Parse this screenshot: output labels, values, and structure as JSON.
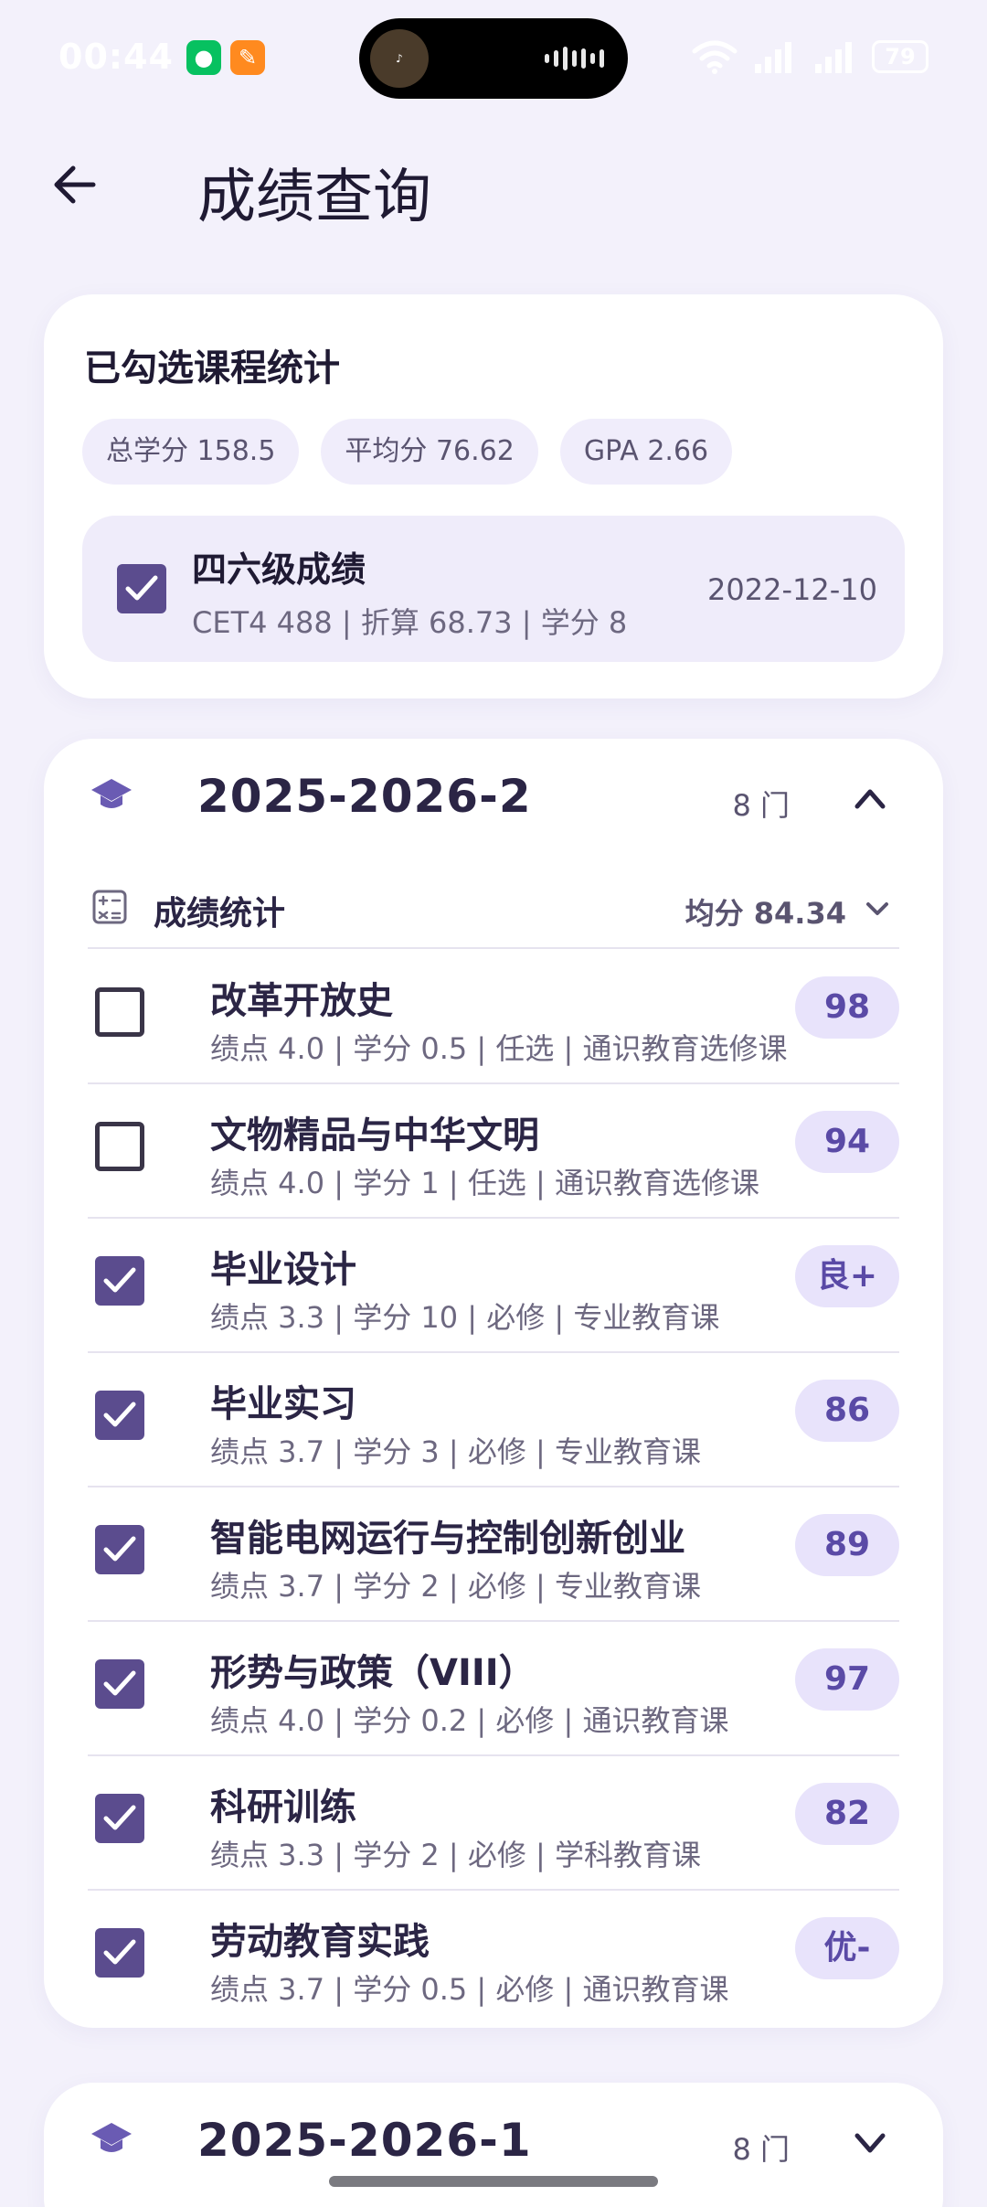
{
  "status_bar": {
    "time": "00:44",
    "battery": "79"
  },
  "header": {
    "title": "成绩查询"
  },
  "summary": {
    "title": "已勾选课程统计",
    "chips": [
      "总学分 158.5",
      "平均分 76.62",
      "GPA 2.66"
    ],
    "cet": {
      "title": "四六级成绩",
      "subtitle": "CET4 488 | 折算 68.73 | 学分 8",
      "date": "2022-12-10",
      "checked": true
    }
  },
  "terms": [
    {
      "title": "2025-2026-2",
      "count": "8 门",
      "expanded": true,
      "stats_label": "成绩统计",
      "stats_avg": "均分 84.34",
      "courses": [
        {
          "name": "改革开放史",
          "meta": "绩点 4.0 | 学分 0.5 | 任选 | 通识教育选修课",
          "score": "98",
          "checked": false
        },
        {
          "name": "文物精品与中华文明",
          "meta": "绩点 4.0 | 学分 1 | 任选 | 通识教育选修课",
          "score": "94",
          "checked": false
        },
        {
          "name": "毕业设计",
          "meta": "绩点 3.3 | 学分 10 | 必修 | 专业教育课",
          "score": "良+",
          "checked": true
        },
        {
          "name": "毕业实习",
          "meta": "绩点 3.7 | 学分 3 | 必修 | 专业教育课",
          "score": "86",
          "checked": true
        },
        {
          "name": "智能电网运行与控制创新创业",
          "meta": "绩点 3.7 | 学分 2 | 必修 | 专业教育课",
          "score": "89",
          "checked": true
        },
        {
          "name": "形势与政策（VIII）",
          "meta": "绩点 4.0 | 学分 0.2 | 必修 | 通识教育课",
          "score": "97",
          "checked": true
        },
        {
          "name": "科研训练",
          "meta": "绩点 3.3 | 学分 2 | 必修 | 学科教育课",
          "score": "82",
          "checked": true
        },
        {
          "name": "劳动教育实践",
          "meta": "绩点 3.7 | 学分 0.5 | 必修 | 通识教育课",
          "score": "优-",
          "checked": true
        }
      ]
    },
    {
      "title": "2025-2026-1",
      "count": "8 门",
      "expanded": false
    }
  ],
  "colors": {
    "accent": "#5b4c8e",
    "badge_bg": "#e8e3fb",
    "badge_text": "#5a4aa6",
    "page_bg": "#f3f1fb"
  },
  "icons": [
    "back-arrow-icon",
    "graduation-cap-icon",
    "calculator-icon",
    "chevron-up-icon",
    "chevron-down-icon",
    "check-icon"
  ]
}
